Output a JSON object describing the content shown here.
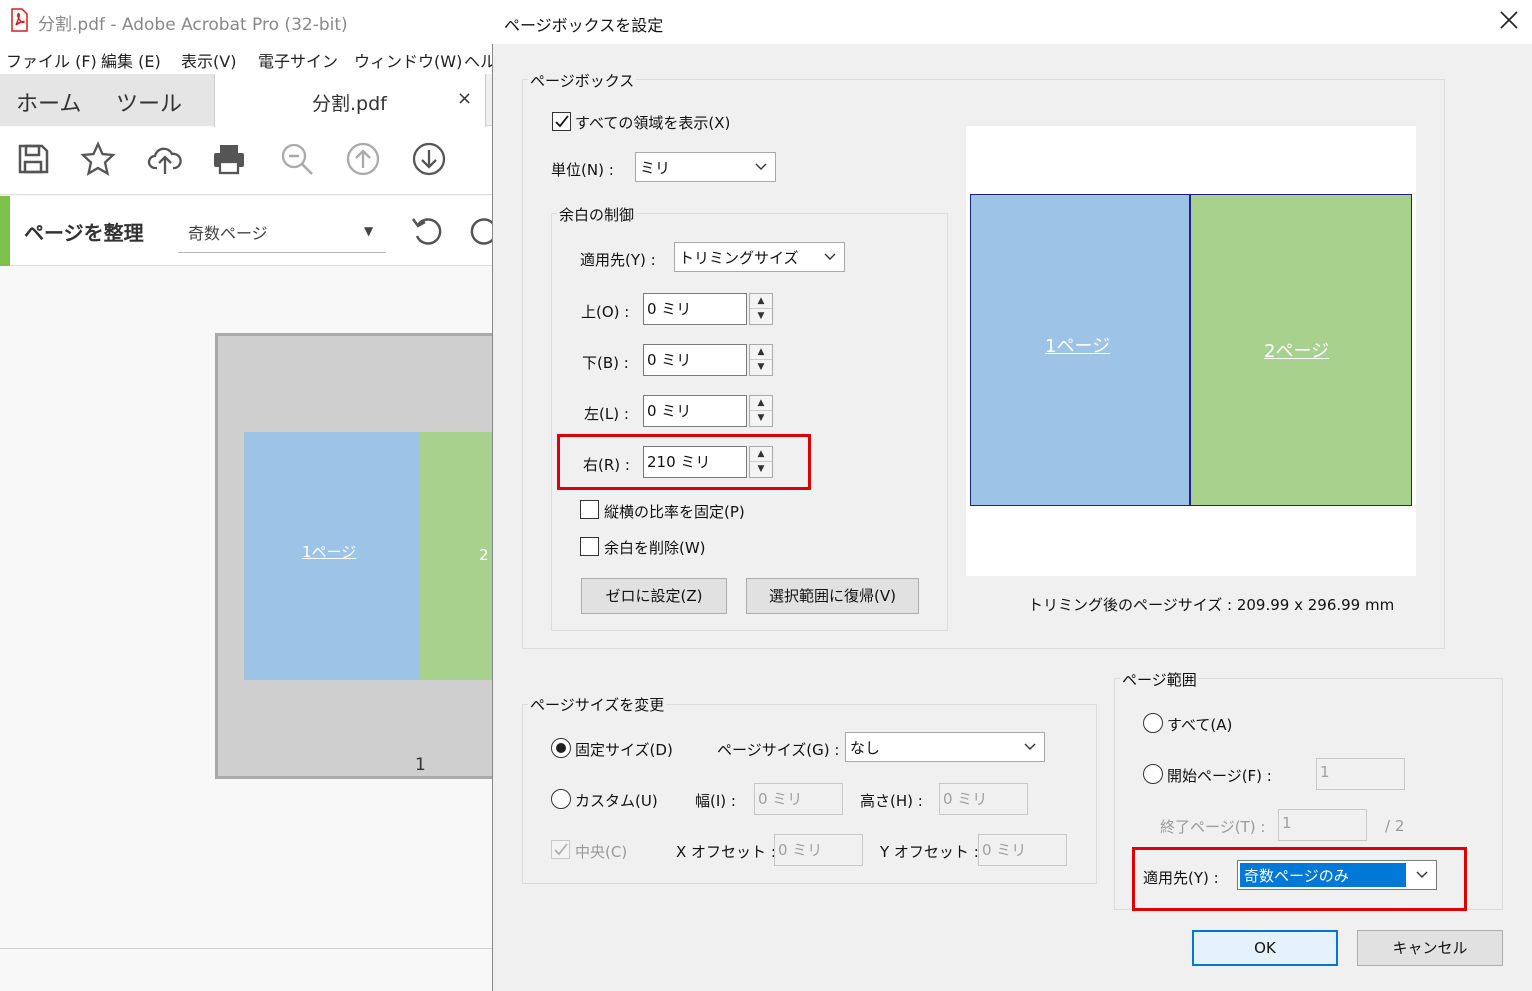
{
  "app": {
    "title": "分割.pdf - Adobe Acrobat Pro (32-bit)",
    "menu": [
      "ファイル (F)",
      "編集 (E)",
      "表示(V)",
      "電子サイン",
      "ウィンドウ(W)",
      "ヘル"
    ],
    "tabs": {
      "home": "ホーム",
      "tools": "ツール",
      "document": "分割.pdf",
      "close": "×"
    },
    "toolbar_icons": [
      "save-icon",
      "star-icon",
      "cloud-upload-icon",
      "print-icon",
      "zoom-out-icon",
      "arrow-up-circle-icon",
      "arrow-down-circle-icon"
    ],
    "organize": {
      "title": "ページを整理",
      "filter_value": "奇数ページ"
    },
    "thumbnail": {
      "page1_label": "1ページ",
      "page2_label": "2",
      "page_number": "1"
    },
    "colors": {
      "accent_green": "#7cc24a",
      "page_blue": "#9dc3e6",
      "page_green": "#a9d18e"
    }
  },
  "dialog": {
    "title": "ページボックスを設定",
    "pagebox": {
      "group_title": "ページボックス",
      "show_all": "すべての領域を表示(X)",
      "unit_label": "単位(N) :",
      "unit_value": "ミリ",
      "margins": {
        "group_title": "余白の制御",
        "apply_label": "適用先(Y) :",
        "apply_value": "トリミングサイズ",
        "top_label": "上(O) :",
        "top_value": "0 ミリ",
        "bottom_label": "下(B) :",
        "bottom_value": "0 ミリ",
        "left_label": "左(L) :",
        "left_value": "0 ミリ",
        "right_label": "右(R) :",
        "right_value": "210 ミリ",
        "lock_ratio": "縦横の比率を固定(P)",
        "remove_white": "余白を削除(W)",
        "set_zero": "ゼロに設定(Z)",
        "revert": "選択範囲に復帰(V)"
      },
      "preview": {
        "page1": "1ページ",
        "page2": "2ページ"
      },
      "crop_size": "トリミング後のページサイズ : 209.99 x 296.99 mm"
    },
    "pagesize": {
      "group_title": "ページサイズを変更",
      "fixed": "固定サイズ(D)",
      "size_label": "ページサイズ(G) :",
      "size_value": "なし",
      "custom": "カスタム(U)",
      "width_label": "幅(I) :",
      "width_value": "0 ミリ",
      "height_label": "高さ(H) :",
      "height_value": "0 ミリ",
      "center": "中央(C)",
      "xoffset_label": "X オフセット :",
      "xoffset_value": "0 ミリ",
      "yoffset_label": "Y オフセット :",
      "yoffset_value": "0 ミリ"
    },
    "pagerange": {
      "group_title": "ページ範囲",
      "all": "すべて(A)",
      "from_label": "開始ページ(F) :",
      "from_value": "1",
      "to_label": "終了ページ(T) :",
      "to_value": "1",
      "total": "/ 2",
      "apply_label": "適用先(Y) :",
      "apply_value": "奇数ページのみ"
    },
    "ok": "OK",
    "cancel": "キャンセル"
  }
}
